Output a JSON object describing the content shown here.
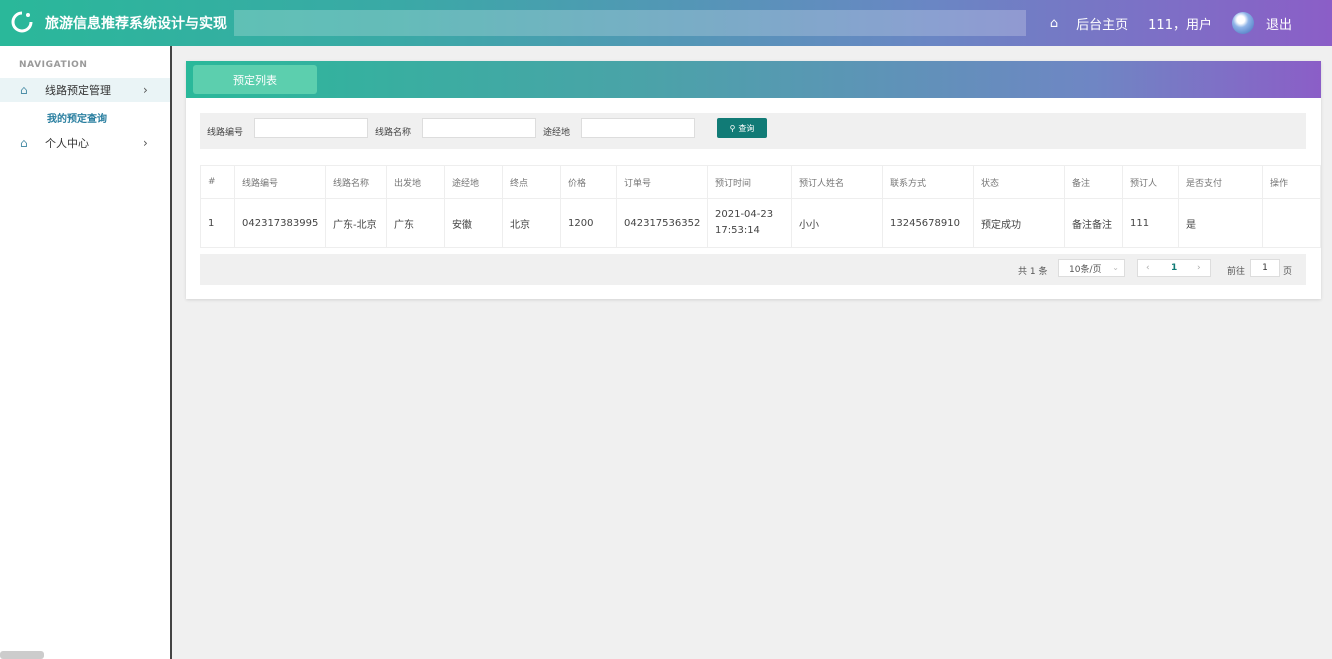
{
  "header": {
    "title": "旅游信息推荐系统设计与实现",
    "home_label": "后台主页",
    "user_label": "111，用户",
    "logout_label": "退出"
  },
  "sidebar": {
    "caption": "NAVIGATION",
    "items": [
      {
        "label": "线路预定管理",
        "icon": "home-icon"
      },
      {
        "label": "个人中心",
        "icon": "home-icon"
      }
    ],
    "sub_items": [
      {
        "label": "我的预定查询"
      }
    ]
  },
  "panel": {
    "tab_label": "预定列表",
    "filters": {
      "route_no_label": "线路编号",
      "route_name_label": "线路名称",
      "via_label": "途经地",
      "query_label": "查询"
    },
    "table": {
      "columns": [
        "#",
        "线路编号",
        "线路名称",
        "出发地",
        "途经地",
        "终点",
        "价格",
        "订单号",
        "预订时间",
        "预订人姓名",
        "联系方式",
        "状态",
        "备注",
        "预订人",
        "是否支付",
        "操作"
      ],
      "rows": [
        [
          "1",
          "042317383995",
          "广东-北京",
          "广东",
          "安徽",
          "北京",
          "1200",
          "042317536352",
          "2021-04-23 17:53:14",
          "小小",
          "13245678910",
          "预定成功",
          "备注备注",
          "111",
          "是",
          ""
        ]
      ]
    },
    "pagination": {
      "total": "共 1 条",
      "page_size": "10条/页",
      "current_page": "1",
      "goto_label": "前往",
      "goto_value": "1",
      "page_unit": "页"
    }
  },
  "colors": {
    "header_start": "#2ab89a",
    "header_end": "#8b5ec7",
    "accent": "#117b76"
  }
}
